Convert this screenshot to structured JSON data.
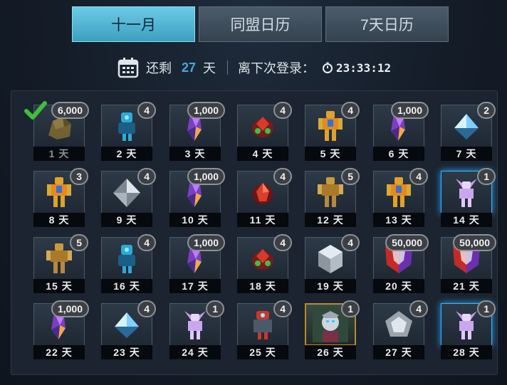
{
  "tabs": [
    {
      "label": "十一月",
      "active": true
    },
    {
      "label": "同盟日历",
      "active": false
    },
    {
      "label": "7天日历",
      "active": false
    }
  ],
  "info": {
    "remaining_prefix": "还剩",
    "remaining_days": "27",
    "remaining_suffix": "天",
    "next_login_label": "离下次登录：",
    "timer": "23:33:12"
  },
  "rewards": [
    {
      "day": "1 天",
      "qty": "6,000",
      "icon": "gold-ore-icon",
      "claimed": true
    },
    {
      "day": "2 天",
      "qty": "4",
      "icon": "blue-robot-part-icon"
    },
    {
      "day": "3 天",
      "qty": "1,000",
      "icon": "energon-crystal-icon"
    },
    {
      "day": "4 天",
      "qty": "4",
      "icon": "red-green-core-icon"
    },
    {
      "day": "5 天",
      "qty": "4",
      "icon": "orange-robot-icon"
    },
    {
      "day": "6 天",
      "qty": "1,000",
      "icon": "energon-crystal-icon"
    },
    {
      "day": "7 天",
      "qty": "2",
      "icon": "blue-diamond-icon"
    },
    {
      "day": "8 天",
      "qty": "3",
      "icon": "orange-robot-icon"
    },
    {
      "day": "9 天",
      "qty": "4",
      "icon": "silver-diamond-icon"
    },
    {
      "day": "10 天",
      "qty": "1,000",
      "icon": "energon-crystal-icon"
    },
    {
      "day": "11 天",
      "qty": "4",
      "icon": "red-core-icon"
    },
    {
      "day": "12 天",
      "qty": "5",
      "icon": "gold-robot-icon"
    },
    {
      "day": "13 天",
      "qty": "4",
      "icon": "orange-robot-icon"
    },
    {
      "day": "14 天",
      "qty": "1",
      "icon": "pink-robot-icon",
      "glow": true
    },
    {
      "day": "15 天",
      "qty": "5",
      "icon": "gold-robot-icon"
    },
    {
      "day": "16 天",
      "qty": "4",
      "icon": "blue-robot-part-icon"
    },
    {
      "day": "17 天",
      "qty": "1,000",
      "icon": "energon-crystal-icon"
    },
    {
      "day": "18 天",
      "qty": "4",
      "icon": "red-green-core-icon"
    },
    {
      "day": "19 天",
      "qty": "4",
      "icon": "silver-die-icon"
    },
    {
      "day": "20 天",
      "qty": "50,000",
      "icon": "faction-shield-icon"
    },
    {
      "day": "21 天",
      "qty": "50,000",
      "icon": "faction-shield-icon"
    },
    {
      "day": "22 天",
      "qty": "1,000",
      "icon": "energon-crystal-icon"
    },
    {
      "day": "23 天",
      "qty": "4",
      "icon": "blue-diamond-icon"
    },
    {
      "day": "24 天",
      "qty": "1",
      "icon": "pink-robot-icon"
    },
    {
      "day": "25 天",
      "qty": "4",
      "icon": "red-robot-part-icon"
    },
    {
      "day": "26 天",
      "qty": "1",
      "icon": "character-portrait-icon",
      "portrait": true
    },
    {
      "day": "27 天",
      "qty": "4",
      "icon": "silver-pentagon-icon"
    },
    {
      "day": "28 天",
      "qty": "1",
      "icon": "pink-robot-icon",
      "glow": true
    }
  ],
  "colors": {
    "accent": "#48a7d6",
    "active_tab": "#5cbcdc",
    "glow": "#2aa6ff",
    "check": "#3fbf3a"
  }
}
